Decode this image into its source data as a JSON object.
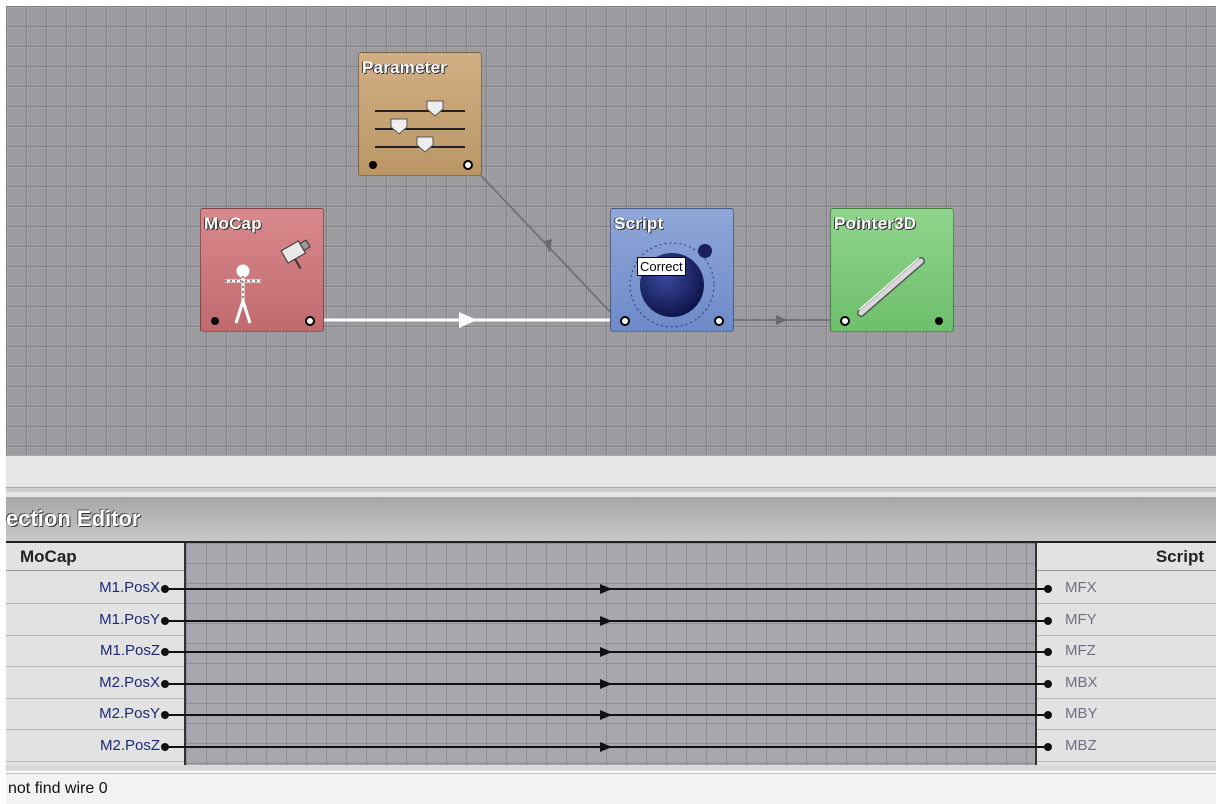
{
  "nodes": {
    "parameter": {
      "title": "Parameter"
    },
    "mocap": {
      "title": "MoCap"
    },
    "script": {
      "title": "Script",
      "tooltip": "Correct"
    },
    "pointer3d": {
      "title": "Pointer3D"
    }
  },
  "editor": {
    "title": "ection Editor",
    "source_header": "MoCap",
    "target_header": "Script",
    "connections": [
      {
        "source": "M1.PosX",
        "target": "MFX"
      },
      {
        "source": "M1.PosY",
        "target": "MFY"
      },
      {
        "source": "M1.PosZ",
        "target": "MFZ"
      },
      {
        "source": "M2.PosX",
        "target": "MBX"
      },
      {
        "source": "M2.PosY",
        "target": "MBY"
      },
      {
        "source": "M2.PosZ",
        "target": "MBZ"
      }
    ]
  },
  "status": {
    "text": "not find wire 0"
  },
  "colors": {
    "canvas": "#9b9ba0",
    "parameter_node": "#c9a679",
    "mocap_node": "#cf7b7f",
    "script_node": "#7e98d0",
    "pointer3d_node": "#7fcb7c",
    "active_wire": "#ffffff",
    "source_label": "#1b2a7a",
    "target_label": "#6f7080"
  },
  "icons": {
    "parameter": "sliders-icon",
    "mocap": "motion-capture-figure-icon",
    "script": "sphere-icon",
    "pointer3d": "pointer-stick-icon"
  }
}
